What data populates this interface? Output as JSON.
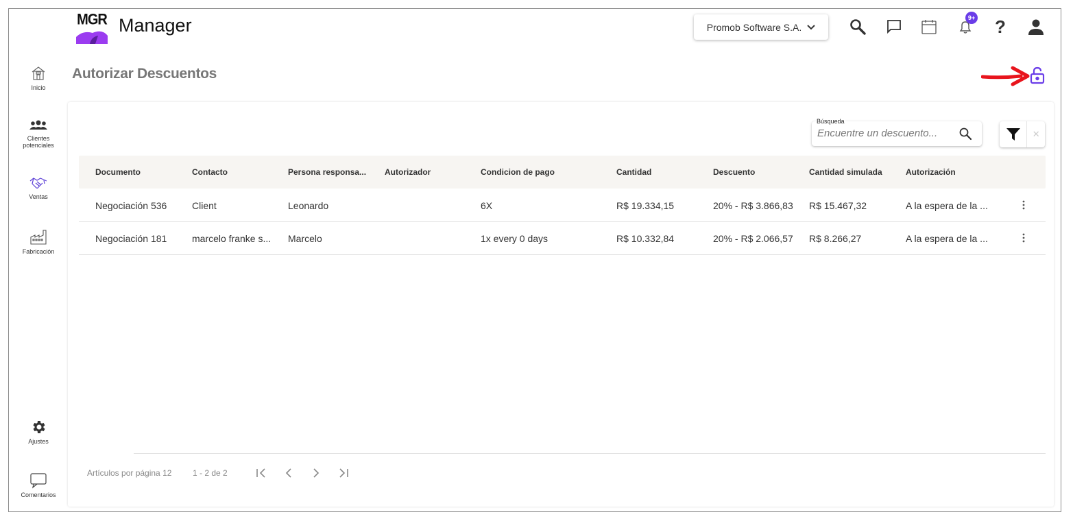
{
  "sidebar": {
    "items": [
      {
        "label": "Inicio",
        "icon": "house-icon"
      },
      {
        "label": "Clientes potenciales",
        "icon": "group-icon"
      },
      {
        "label": "Ventas",
        "icon": "handshake-icon"
      },
      {
        "label": "Fabricación",
        "icon": "factory-icon"
      },
      {
        "label": "Ajustes",
        "icon": "gear-icon"
      },
      {
        "label": "Comentarios",
        "icon": "comment-icon"
      }
    ]
  },
  "header": {
    "logo_text": "MGR",
    "app_name": "Manager",
    "company": "Promob Software S.A.",
    "notification_badge": "9+",
    "help_label": "?"
  },
  "page": {
    "title": "Autorizar Descuentos"
  },
  "search": {
    "label": "Búsqueda",
    "placeholder": "Encuentre un descuento..."
  },
  "filter": {
    "clear_label": "✕"
  },
  "table": {
    "columns": [
      "Documento",
      "Contacto",
      "Persona responsa...",
      "Autorizador",
      "Condicion de pago",
      "Cantidad",
      "Descuento",
      "Cantidad simulada",
      "Autorización"
    ],
    "rows": [
      {
        "documento": "Negociación 536",
        "contacto": "Client",
        "persona": "Leonardo",
        "autorizador": "",
        "condicion": "6X",
        "cantidad": "R$ 19.334,15",
        "descuento": "20% - R$ 3.866,83",
        "simulada": "R$ 15.467,32",
        "autorizacion": "A la espera de la ..."
      },
      {
        "documento": "Negociación 181",
        "contacto": "marcelo franke s...",
        "persona": "Marcelo",
        "autorizador": "",
        "condicion": "1x every 0 days",
        "cantidad": "R$ 10.332,84",
        "descuento": "20% - R$ 2.066,57",
        "simulada": "R$ 8.266,27",
        "autorizacion": "A la espera de la ..."
      }
    ]
  },
  "pagination": {
    "per_page_label": "Artículos por página 12",
    "range_label": "1 - 2 de 2"
  },
  "colors": {
    "accent": "#6a3de8",
    "annotation_arrow": "#e8141c",
    "logo_purple": "#9b3cf0"
  }
}
